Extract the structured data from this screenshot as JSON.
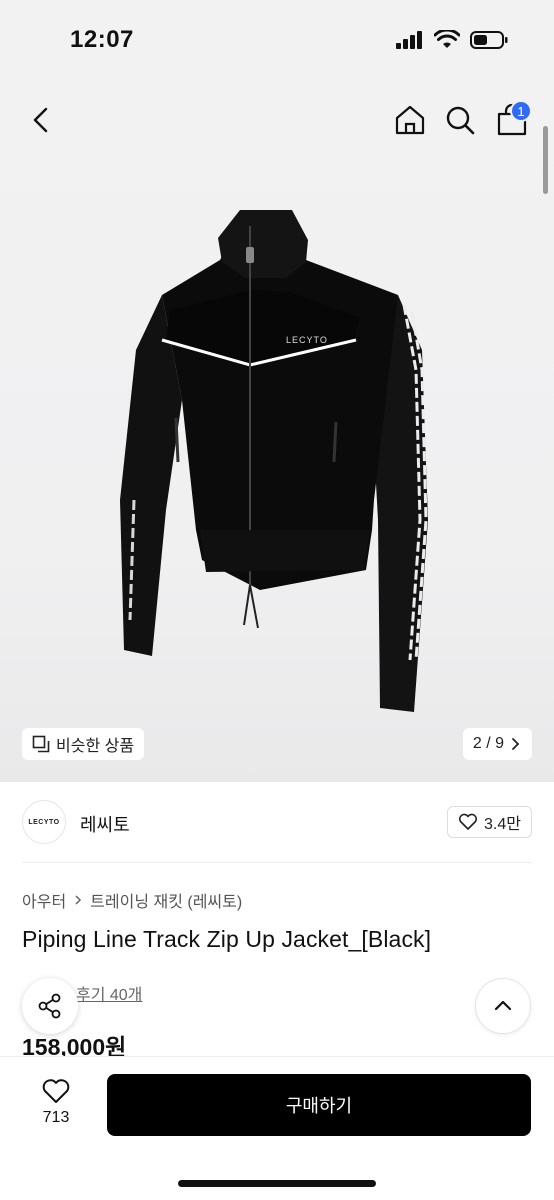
{
  "status_bar": {
    "time": "12:07"
  },
  "header": {
    "cart_count": "1",
    "icons": [
      "back-icon",
      "home-icon",
      "search-icon",
      "cart-icon"
    ]
  },
  "gallery": {
    "similar_label": "비슷한 상품",
    "page_indicator": "2 / 9",
    "product_logo_text": "LECYTO"
  },
  "brand": {
    "logo_text": "LECYTO",
    "name": "레씨토",
    "likes": "3.4만"
  },
  "breadcrumb": {
    "category": "아우터",
    "subcategory": "트레이닝 재킷 (레씨토)"
  },
  "product": {
    "title": "Piping Line Track Zip Up Jacket_[Black]",
    "reviews_label": "후기 40개",
    "price": "158,000원"
  },
  "bottom_bar": {
    "wish_count": "713",
    "buy_label": "구매하기"
  },
  "colors": {
    "accent": "#2f6cf6",
    "buy_button": "#000000",
    "background": "#f2f2f3"
  }
}
